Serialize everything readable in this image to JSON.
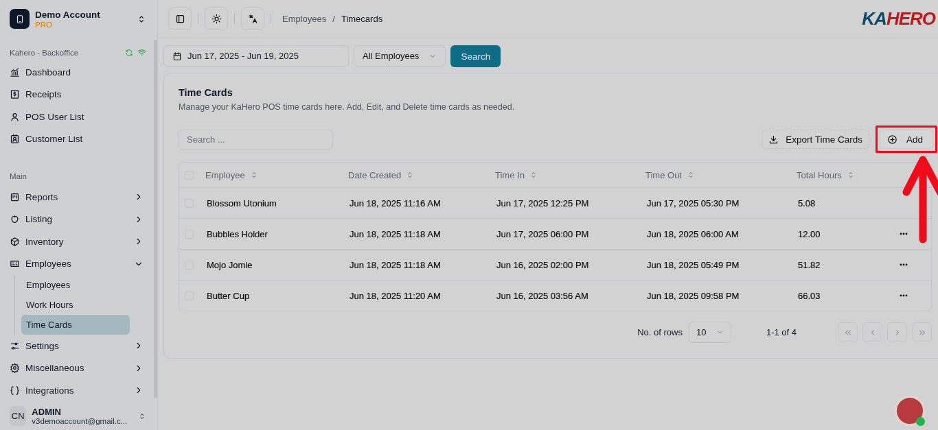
{
  "account": {
    "name": "Demo Account",
    "plan": "PRO"
  },
  "sidebar": {
    "store": "Kahero - Backoffice",
    "items": [
      {
        "kind": "item",
        "label": "Dashboard"
      },
      {
        "kind": "item",
        "label": "Receipts"
      },
      {
        "kind": "item",
        "label": "POS User List"
      },
      {
        "kind": "item",
        "label": "Customer List"
      },
      {
        "kind": "section",
        "label": "Main"
      },
      {
        "kind": "group",
        "label": "Reports",
        "expanded": false
      },
      {
        "kind": "group",
        "label": "Listing",
        "expanded": false
      },
      {
        "kind": "group",
        "label": "Inventory",
        "expanded": false
      },
      {
        "kind": "group",
        "label": "Employees",
        "expanded": true,
        "children": [
          {
            "label": "Employees",
            "selected": false
          },
          {
            "label": "Work Hours",
            "selected": false
          },
          {
            "label": "Time Cards",
            "selected": true
          }
        ]
      },
      {
        "kind": "group",
        "label": "Settings",
        "expanded": false
      },
      {
        "kind": "group",
        "label": "Miscellaneous",
        "expanded": false
      },
      {
        "kind": "group",
        "label": "Integrations",
        "expanded": false
      }
    ]
  },
  "user": {
    "initials": "CN",
    "name": "ADMIN",
    "email": "v3demoaccount@gmail.c..."
  },
  "breadcrumb": {
    "items": [
      "Employees",
      "Timecards"
    ],
    "separator": "/"
  },
  "logo": {
    "part_1": "KA",
    "part_2": "HERO"
  },
  "filters": {
    "date_range": "Jun 17, 2025 - Jun 19, 2025",
    "employee_select": "All Employees",
    "search_button": "Search"
  },
  "panel": {
    "title": "Time Cards",
    "description": "Manage your KaHero POS time cards here. Add, Edit, and Delete time cards as needed.",
    "search_placeholder": "Search ...",
    "export_button": "Export Time Cards",
    "add_button": "Add"
  },
  "table": {
    "all_checked": false,
    "columns": [
      "Employee",
      "Date Created",
      "Time In",
      "Time Out",
      "Total Hours"
    ],
    "rows": [
      {
        "checked": false,
        "actions_visible": false,
        "cells": [
          "Blossom Utonium",
          "Jun 18, 2025 11:16 AM",
          "Jun 17, 2025 12:25 PM",
          "Jun 17, 2025 05:30 PM",
          "5.08"
        ]
      },
      {
        "checked": false,
        "actions_visible": true,
        "cells": [
          "Bubbles Holder",
          "Jun 18, 2025 11:18 AM",
          "Jun 17, 2025 06:00 PM",
          "Jun 18, 2025 06:00 AM",
          "12.00"
        ]
      },
      {
        "checked": false,
        "actions_visible": true,
        "cells": [
          "Mojo Jomie",
          "Jun 18, 2025 11:18 AM",
          "Jun 16, 2025 02:00 PM",
          "Jun 18, 2025 05:49 PM",
          "51.82"
        ]
      },
      {
        "checked": false,
        "actions_visible": true,
        "cells": [
          "Butter Cup",
          "Jun 18, 2025 11:20 AM",
          "Jun 16, 2025 03:56 AM",
          "Jun 18, 2025 09:58 PM",
          "66.03"
        ]
      }
    ]
  },
  "pagination": {
    "rows_label": "No. of rows",
    "rows_value": "10",
    "range": "1-1 of 4"
  }
}
